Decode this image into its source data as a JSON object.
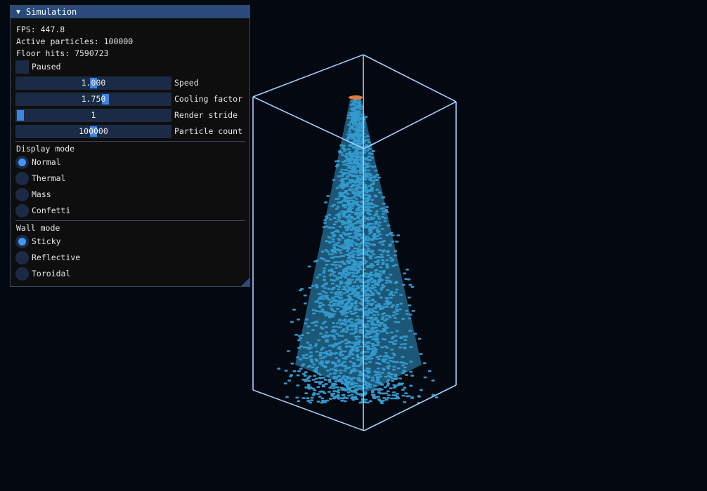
{
  "window": {
    "title": "Simulation",
    "collapse_glyph": "▼"
  },
  "stats": {
    "fps": "FPS: 447.8",
    "active": "Active particles: 100000",
    "floor_hits": "Floor hits: 7590723"
  },
  "paused": {
    "label": "Paused",
    "checked": false
  },
  "sliders": [
    {
      "label": "Speed",
      "value": "1.000",
      "fraction": 0.5
    },
    {
      "label": "Cooling factor",
      "value": "1.750",
      "fraction": 0.58
    },
    {
      "label": "Render stride",
      "value": "1",
      "fraction": 0.0
    },
    {
      "label": "Particle count",
      "value": "100000",
      "fraction": 0.5
    }
  ],
  "display_mode": {
    "heading": "Display mode",
    "options": [
      "Normal",
      "Thermal",
      "Mass",
      "Confetti"
    ],
    "selected": "Normal"
  },
  "wall_mode": {
    "heading": "Wall mode",
    "options": [
      "Sticky",
      "Reflective",
      "Toroidal"
    ],
    "selected": "Sticky"
  },
  "colors": {
    "background": "#040810",
    "box_edges": "#9fd0ff",
    "particles": "#3399cc",
    "emitter": "#e07a3a",
    "accent": "#4296fa",
    "frame_bg": "#1c2b45",
    "title_bg": "#294a7a"
  }
}
